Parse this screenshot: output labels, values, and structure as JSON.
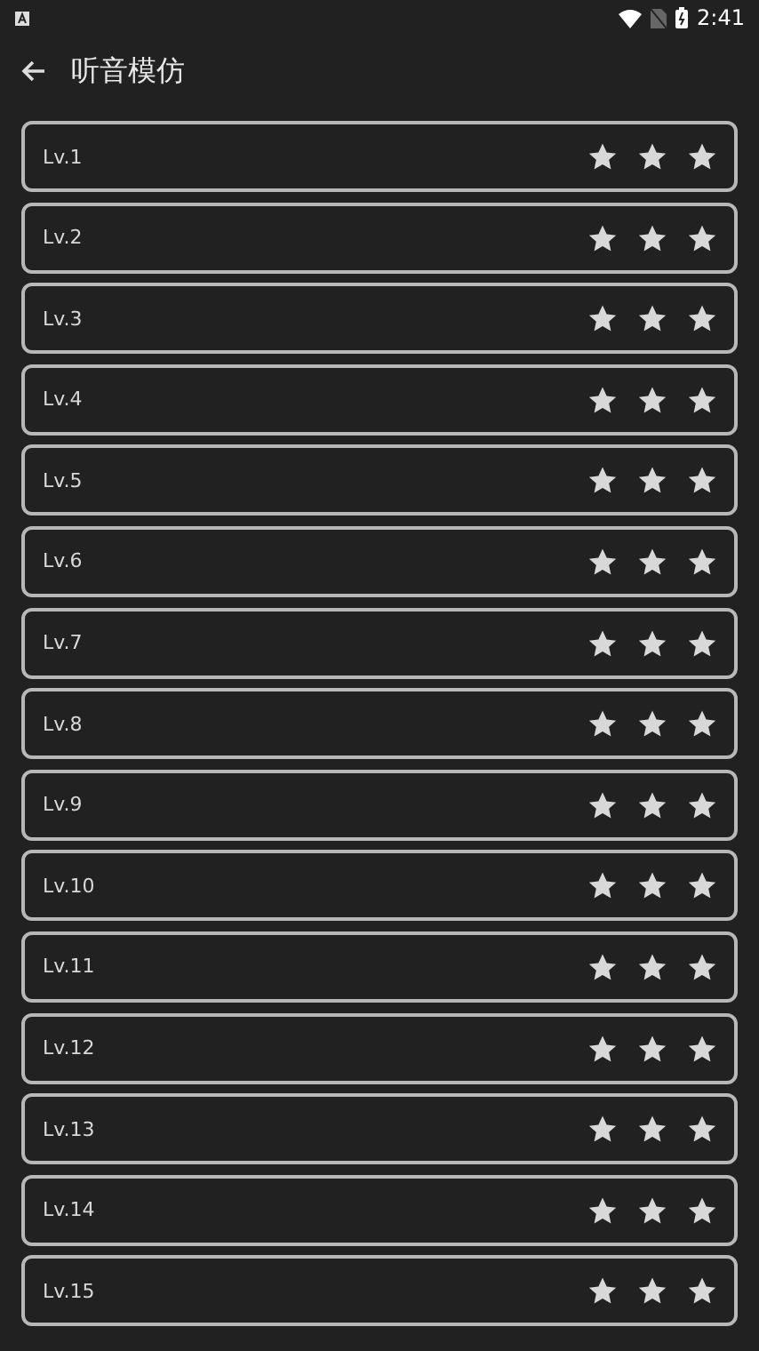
{
  "status_bar": {
    "time": "2:41"
  },
  "toolbar": {
    "title": "听音模仿"
  },
  "levels": [
    {
      "label": "Lv.1",
      "stars": 3
    },
    {
      "label": "Lv.2",
      "stars": 3
    },
    {
      "label": "Lv.3",
      "stars": 3
    },
    {
      "label": "Lv.4",
      "stars": 3
    },
    {
      "label": "Lv.5",
      "stars": 3
    },
    {
      "label": "Lv.6",
      "stars": 3
    },
    {
      "label": "Lv.7",
      "stars": 3
    },
    {
      "label": "Lv.8",
      "stars": 3
    },
    {
      "label": "Lv.9",
      "stars": 3
    },
    {
      "label": "Lv.10",
      "stars": 3
    },
    {
      "label": "Lv.11",
      "stars": 3
    },
    {
      "label": "Lv.12",
      "stars": 3
    },
    {
      "label": "Lv.13",
      "stars": 3
    },
    {
      "label": "Lv.14",
      "stars": 3
    },
    {
      "label": "Lv.15",
      "stars": 3
    }
  ]
}
